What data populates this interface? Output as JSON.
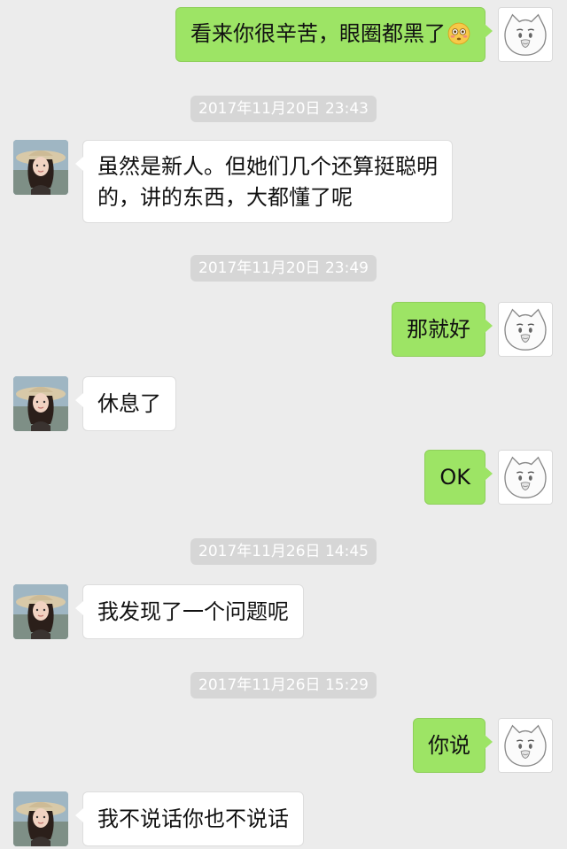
{
  "colors": {
    "background": "#ececec",
    "sent_bubble": "#9de465",
    "received_bubble": "#ffffff",
    "timestamp_bg": "#d6d6d6",
    "timestamp_text": "#ffffff"
  },
  "messages": [
    {
      "from": "me",
      "text": "看来你很辛苦，眼圈都黑了",
      "emoji": "flushed-face-emoji"
    },
    {
      "type": "timestamp",
      "text": "2017年11月20日 23:43"
    },
    {
      "from": "her",
      "lines": [
        "虽然是新人。但她们几个还算挺聪明",
        "的，讲的东西，大都懂了呢"
      ]
    },
    {
      "type": "timestamp",
      "text": "2017年11月20日 23:49"
    },
    {
      "from": "me",
      "text": "那就好"
    },
    {
      "from": "her",
      "text": "休息了"
    },
    {
      "from": "me",
      "text": "OK"
    },
    {
      "type": "timestamp",
      "text": "2017年11月26日 14:45"
    },
    {
      "from": "her",
      "text": "我发现了一个问题呢"
    },
    {
      "type": "timestamp",
      "text": "2017年11月26日 15:29"
    },
    {
      "from": "me",
      "text": "你说"
    },
    {
      "from": "her",
      "text": "我不说话你也不说话"
    }
  ],
  "avatars": {
    "me": "cartoon-cat-face-avatar",
    "her": "girl-in-sun-hat-photo-avatar"
  }
}
